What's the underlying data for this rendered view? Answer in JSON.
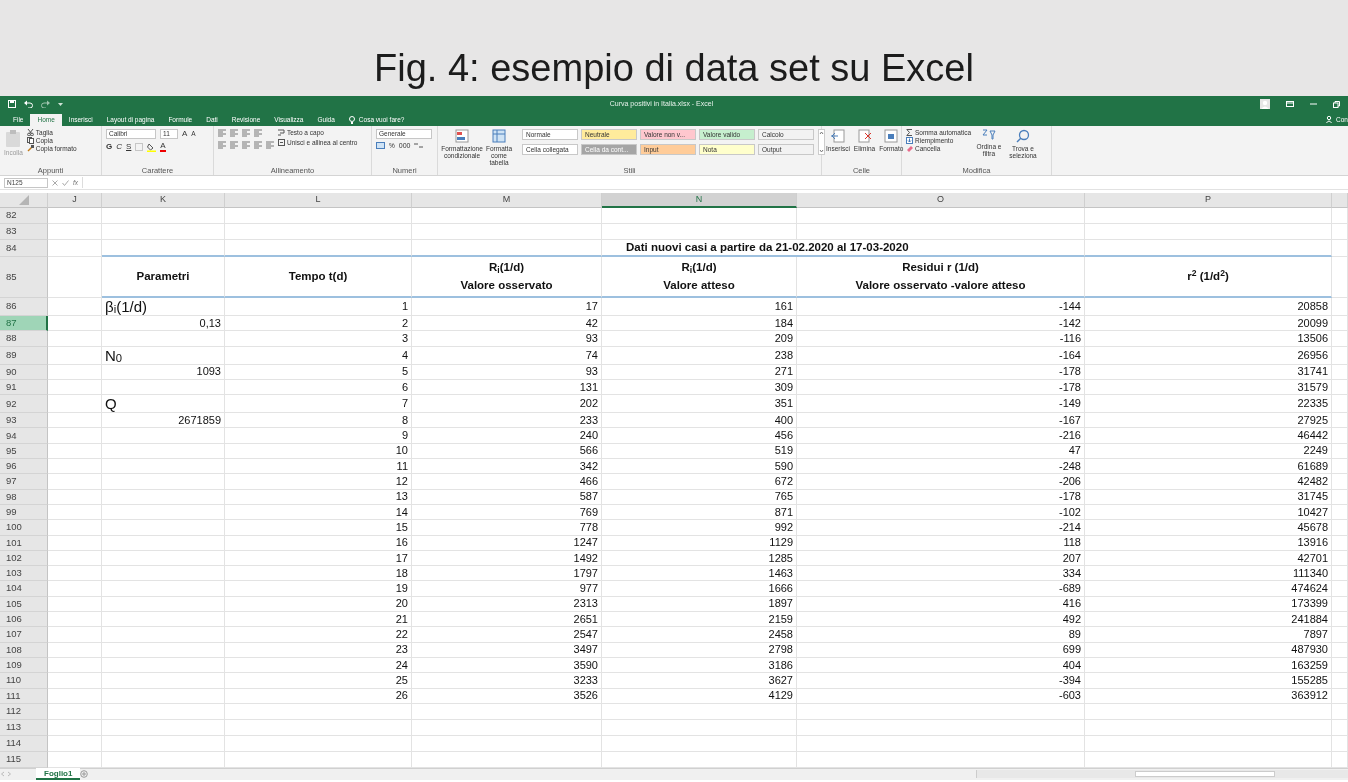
{
  "slide_title": "Fig. 4: esempio di data set su Excel",
  "excel": {
    "window_title": "Curva positivi in Italia.xlsx  -  Excel",
    "ribbon_tabs": [
      {
        "label": "File",
        "selected": false
      },
      {
        "label": "Home",
        "selected": true
      },
      {
        "label": "Inserisci",
        "selected": false
      },
      {
        "label": "Layout di pagina",
        "selected": false
      },
      {
        "label": "Formule",
        "selected": false
      },
      {
        "label": "Dati",
        "selected": false
      },
      {
        "label": "Revisione",
        "selected": false
      },
      {
        "label": "Visualizza",
        "selected": false
      },
      {
        "label": "Guida",
        "selected": false
      }
    ],
    "tell_me": "Cosa vuoi fare?",
    "share_label": "Con",
    "ribbon": {
      "clipboard": {
        "label": "Appunti",
        "paste": "Incolla",
        "items": [
          "Taglia",
          "Copia",
          "Copia formato"
        ]
      },
      "font": {
        "label": "Carattere",
        "font_name": "Calibri",
        "font_size": "11",
        "grow": "A",
        "shrink": "A",
        "styles": [
          "G",
          "C",
          "S"
        ],
        "font_color": "A"
      },
      "alignment": {
        "label": "Allineamento",
        "wrap": "Testo a capo",
        "merge": "Unisci e allinea al centro"
      },
      "number": {
        "label": "Numeri",
        "format": "Generale",
        "percent": "%",
        "thousands": "000"
      },
      "styles": {
        "label": "Stili",
        "conditional": "Formattazione condizionale",
        "format_table": "Formatta come tabella",
        "cell_styles": [
          {
            "label": "Normale",
            "color": "#ffffff"
          },
          {
            "label": "Neutrale",
            "color": "#ffeb9c"
          },
          {
            "label": "Valore non v...",
            "color": "#ffc7ce"
          },
          {
            "label": "Valore valido",
            "color": "#c6efce"
          },
          {
            "label": "Calcolo",
            "color": "#f2f2f2"
          },
          {
            "label": "Cella collegata",
            "color": "#ffffff"
          },
          {
            "label": "Cella da cont...",
            "color": "#a5a5a5"
          },
          {
            "label": "Input",
            "color": "#ffcc99"
          },
          {
            "label": "Nota",
            "color": "#ffffcc"
          },
          {
            "label": "Output",
            "color": "#f2f2f2"
          }
        ]
      },
      "cells": {
        "label": "Celle",
        "buttons": [
          "Inserisci",
          "Elimina",
          "Formato"
        ]
      },
      "editing": {
        "label": "Modifica",
        "items": [
          "Somma automatica",
          "Riempimento",
          "Cancella"
        ],
        "sort": "Ordina e filtra",
        "find": "Trova e seleziona"
      }
    },
    "formula_bar": {
      "name_box": "N125",
      "fx": "fx"
    },
    "columns": [
      {
        "label": "J",
        "selected": false
      },
      {
        "label": "K",
        "selected": false
      },
      {
        "label": "L",
        "selected": false
      },
      {
        "label": "M",
        "selected": false
      },
      {
        "label": "N",
        "selected": true
      },
      {
        "label": "O",
        "selected": false
      },
      {
        "label": "P",
        "selected": false
      }
    ],
    "rows": [
      {
        "number": "82",
        "selected": false,
        "kind": "blank"
      },
      {
        "number": "83",
        "selected": false,
        "kind": "blank"
      },
      {
        "number": "84",
        "selected": false,
        "kind": "title",
        "title": "Dati nuovi casi a partire da 21-02.2020 al 17-03-2020"
      },
      {
        "number": "85",
        "selected": false,
        "kind": "header",
        "headers": [
          [
            "Parametri"
          ],
          [
            "Tempo t(d)"
          ],
          [
            "R$_{i}$(1/d)",
            "Valore osservato"
          ],
          [
            "R$_{i}$(1/d)",
            "Valore atteso"
          ],
          [
            "Residui r (1/d)",
            "Valore osservato -valore atteso"
          ],
          [
            "r$^{2}$ (1/d$^{2}$)"
          ]
        ]
      },
      {
        "number": "86",
        "selected": false,
        "kind": "data",
        "param": {
          "kind": "label",
          "text": "β$_{i}$(1/d)"
        },
        "values": [
          "1",
          "17",
          "161",
          "-144",
          "20858"
        ]
      },
      {
        "number": "87",
        "selected": true,
        "kind": "data",
        "param": {
          "kind": "value",
          "text": "0,13"
        },
        "values": [
          "2",
          "42",
          "184",
          "-142",
          "20099"
        ]
      },
      {
        "number": "88",
        "selected": false,
        "kind": "data",
        "values": [
          "3",
          "93",
          "209",
          "-116",
          "13506"
        ]
      },
      {
        "number": "89",
        "selected": false,
        "kind": "data",
        "param": {
          "kind": "label",
          "text": "N$_{0}$"
        },
        "values": [
          "4",
          "74",
          "238",
          "-164",
          "26956"
        ]
      },
      {
        "number": "90",
        "selected": false,
        "kind": "data",
        "param": {
          "kind": "value",
          "text": "1093"
        },
        "values": [
          "5",
          "93",
          "271",
          "-178",
          "31741"
        ]
      },
      {
        "number": "91",
        "selected": false,
        "kind": "data",
        "values": [
          "6",
          "131",
          "309",
          "-178",
          "31579"
        ]
      },
      {
        "number": "92",
        "selected": false,
        "kind": "data",
        "param": {
          "kind": "label",
          "text": "Q"
        },
        "values": [
          "7",
          "202",
          "351",
          "-149",
          "22335"
        ]
      },
      {
        "number": "93",
        "selected": false,
        "kind": "data",
        "param": {
          "kind": "value",
          "text": "2671859"
        },
        "values": [
          "8",
          "233",
          "400",
          "-167",
          "27925"
        ]
      },
      {
        "number": "94",
        "selected": false,
        "kind": "data",
        "values": [
          "9",
          "240",
          "456",
          "-216",
          "46442"
        ]
      },
      {
        "number": "95",
        "selected": false,
        "kind": "data",
        "values": [
          "10",
          "566",
          "519",
          "47",
          "2249"
        ]
      },
      {
        "number": "96",
        "selected": false,
        "kind": "data",
        "values": [
          "11",
          "342",
          "590",
          "-248",
          "61689"
        ]
      },
      {
        "number": "97",
        "selected": false,
        "kind": "data",
        "values": [
          "12",
          "466",
          "672",
          "-206",
          "42482"
        ]
      },
      {
        "number": "98",
        "selected": false,
        "kind": "data",
        "values": [
          "13",
          "587",
          "765",
          "-178",
          "31745"
        ]
      },
      {
        "number": "99",
        "selected": false,
        "kind": "data",
        "values": [
          "14",
          "769",
          "871",
          "-102",
          "10427"
        ]
      },
      {
        "number": "100",
        "selected": false,
        "kind": "data",
        "values": [
          "15",
          "778",
          "992",
          "-214",
          "45678"
        ]
      },
      {
        "number": "101",
        "selected": false,
        "kind": "data",
        "values": [
          "16",
          "1247",
          "1129",
          "118",
          "13916"
        ]
      },
      {
        "number": "102",
        "selected": false,
        "kind": "data",
        "values": [
          "17",
          "1492",
          "1285",
          "207",
          "42701"
        ]
      },
      {
        "number": "103",
        "selected": false,
        "kind": "data",
        "values": [
          "18",
          "1797",
          "1463",
          "334",
          "111340"
        ]
      },
      {
        "number": "104",
        "selected": false,
        "kind": "data",
        "values": [
          "19",
          "977",
          "1666",
          "-689",
          "474624"
        ]
      },
      {
        "number": "105",
        "selected": false,
        "kind": "data",
        "values": [
          "20",
          "2313",
          "1897",
          "416",
          "173399"
        ]
      },
      {
        "number": "106",
        "selected": false,
        "kind": "data",
        "values": [
          "21",
          "2651",
          "2159",
          "492",
          "241884"
        ]
      },
      {
        "number": "107",
        "selected": false,
        "kind": "data",
        "values": [
          "22",
          "2547",
          "2458",
          "89",
          "7897"
        ]
      },
      {
        "number": "108",
        "selected": false,
        "kind": "data",
        "values": [
          "23",
          "3497",
          "2798",
          "699",
          "487930"
        ]
      },
      {
        "number": "109",
        "selected": false,
        "kind": "data",
        "values": [
          "24",
          "3590",
          "3186",
          "404",
          "163259"
        ]
      },
      {
        "number": "110",
        "selected": false,
        "kind": "data",
        "values": [
          "25",
          "3233",
          "3627",
          "-394",
          "155285"
        ]
      },
      {
        "number": "111",
        "selected": false,
        "kind": "data",
        "values": [
          "26",
          "3526",
          "4129",
          "-603",
          "363912"
        ]
      },
      {
        "number": "112",
        "selected": false,
        "kind": "blank"
      },
      {
        "number": "113",
        "selected": false,
        "kind": "blank"
      },
      {
        "number": "114",
        "selected": false,
        "kind": "blank"
      },
      {
        "number": "115",
        "selected": false,
        "kind": "blank"
      }
    ],
    "sheet_tabs": [
      {
        "label": "Foglio1",
        "selected": true
      }
    ]
  }
}
